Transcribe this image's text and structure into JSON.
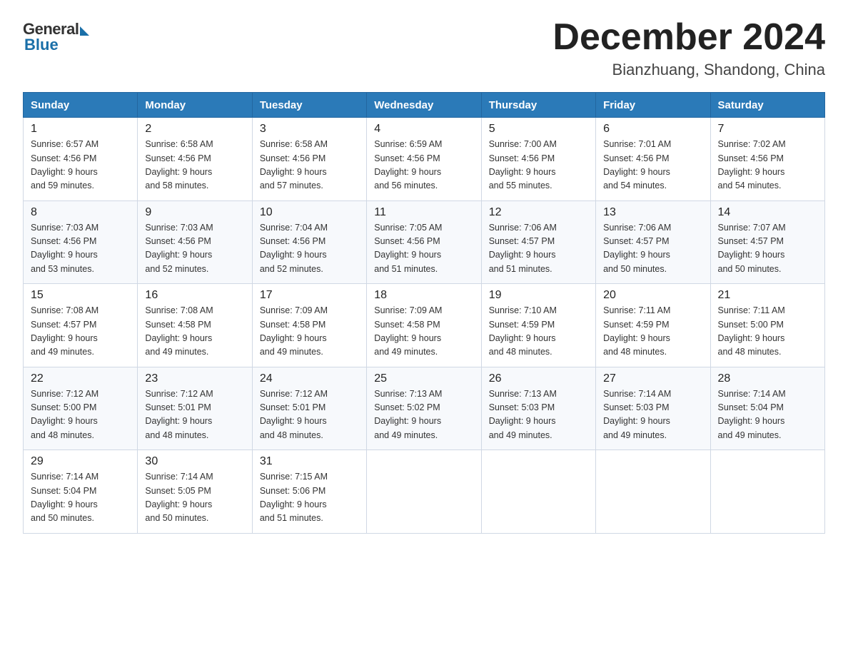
{
  "logo": {
    "general": "General",
    "blue": "Blue"
  },
  "title": {
    "month_year": "December 2024",
    "location": "Bianzhuang, Shandong, China"
  },
  "headers": [
    "Sunday",
    "Monday",
    "Tuesday",
    "Wednesday",
    "Thursday",
    "Friday",
    "Saturday"
  ],
  "weeks": [
    [
      {
        "num": "1",
        "sunrise": "6:57 AM",
        "sunset": "4:56 PM",
        "daylight": "9 hours and 59 minutes."
      },
      {
        "num": "2",
        "sunrise": "6:58 AM",
        "sunset": "4:56 PM",
        "daylight": "9 hours and 58 minutes."
      },
      {
        "num": "3",
        "sunrise": "6:58 AM",
        "sunset": "4:56 PM",
        "daylight": "9 hours and 57 minutes."
      },
      {
        "num": "4",
        "sunrise": "6:59 AM",
        "sunset": "4:56 PM",
        "daylight": "9 hours and 56 minutes."
      },
      {
        "num": "5",
        "sunrise": "7:00 AM",
        "sunset": "4:56 PM",
        "daylight": "9 hours and 55 minutes."
      },
      {
        "num": "6",
        "sunrise": "7:01 AM",
        "sunset": "4:56 PM",
        "daylight": "9 hours and 54 minutes."
      },
      {
        "num": "7",
        "sunrise": "7:02 AM",
        "sunset": "4:56 PM",
        "daylight": "9 hours and 54 minutes."
      }
    ],
    [
      {
        "num": "8",
        "sunrise": "7:03 AM",
        "sunset": "4:56 PM",
        "daylight": "9 hours and 53 minutes."
      },
      {
        "num": "9",
        "sunrise": "7:03 AM",
        "sunset": "4:56 PM",
        "daylight": "9 hours and 52 minutes."
      },
      {
        "num": "10",
        "sunrise": "7:04 AM",
        "sunset": "4:56 PM",
        "daylight": "9 hours and 52 minutes."
      },
      {
        "num": "11",
        "sunrise": "7:05 AM",
        "sunset": "4:56 PM",
        "daylight": "9 hours and 51 minutes."
      },
      {
        "num": "12",
        "sunrise": "7:06 AM",
        "sunset": "4:57 PM",
        "daylight": "9 hours and 51 minutes."
      },
      {
        "num": "13",
        "sunrise": "7:06 AM",
        "sunset": "4:57 PM",
        "daylight": "9 hours and 50 minutes."
      },
      {
        "num": "14",
        "sunrise": "7:07 AM",
        "sunset": "4:57 PM",
        "daylight": "9 hours and 50 minutes."
      }
    ],
    [
      {
        "num": "15",
        "sunrise": "7:08 AM",
        "sunset": "4:57 PM",
        "daylight": "9 hours and 49 minutes."
      },
      {
        "num": "16",
        "sunrise": "7:08 AM",
        "sunset": "4:58 PM",
        "daylight": "9 hours and 49 minutes."
      },
      {
        "num": "17",
        "sunrise": "7:09 AM",
        "sunset": "4:58 PM",
        "daylight": "9 hours and 49 minutes."
      },
      {
        "num": "18",
        "sunrise": "7:09 AM",
        "sunset": "4:58 PM",
        "daylight": "9 hours and 49 minutes."
      },
      {
        "num": "19",
        "sunrise": "7:10 AM",
        "sunset": "4:59 PM",
        "daylight": "9 hours and 48 minutes."
      },
      {
        "num": "20",
        "sunrise": "7:11 AM",
        "sunset": "4:59 PM",
        "daylight": "9 hours and 48 minutes."
      },
      {
        "num": "21",
        "sunrise": "7:11 AM",
        "sunset": "5:00 PM",
        "daylight": "9 hours and 48 minutes."
      }
    ],
    [
      {
        "num": "22",
        "sunrise": "7:12 AM",
        "sunset": "5:00 PM",
        "daylight": "9 hours and 48 minutes."
      },
      {
        "num": "23",
        "sunrise": "7:12 AM",
        "sunset": "5:01 PM",
        "daylight": "9 hours and 48 minutes."
      },
      {
        "num": "24",
        "sunrise": "7:12 AM",
        "sunset": "5:01 PM",
        "daylight": "9 hours and 48 minutes."
      },
      {
        "num": "25",
        "sunrise": "7:13 AM",
        "sunset": "5:02 PM",
        "daylight": "9 hours and 49 minutes."
      },
      {
        "num": "26",
        "sunrise": "7:13 AM",
        "sunset": "5:03 PM",
        "daylight": "9 hours and 49 minutes."
      },
      {
        "num": "27",
        "sunrise": "7:14 AM",
        "sunset": "5:03 PM",
        "daylight": "9 hours and 49 minutes."
      },
      {
        "num": "28",
        "sunrise": "7:14 AM",
        "sunset": "5:04 PM",
        "daylight": "9 hours and 49 minutes."
      }
    ],
    [
      {
        "num": "29",
        "sunrise": "7:14 AM",
        "sunset": "5:04 PM",
        "daylight": "9 hours and 50 minutes."
      },
      {
        "num": "30",
        "sunrise": "7:14 AM",
        "sunset": "5:05 PM",
        "daylight": "9 hours and 50 minutes."
      },
      {
        "num": "31",
        "sunrise": "7:15 AM",
        "sunset": "5:06 PM",
        "daylight": "9 hours and 51 minutes."
      },
      null,
      null,
      null,
      null
    ]
  ]
}
